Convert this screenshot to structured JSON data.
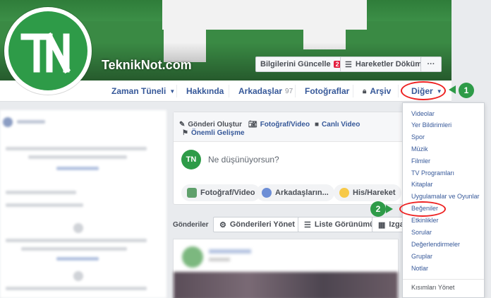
{
  "page": {
    "name": "TeknikNot.com",
    "avatar_letter": "TN"
  },
  "cover_buttons": {
    "update_info": "Bilgilerini Güncelle",
    "update_info_badge": "2",
    "activity_log": "Hareketler Dökümü",
    "more": "···"
  },
  "nav": {
    "timeline": "Zaman Tüneli",
    "about": "Hakkında",
    "friends": "Arkadaşlar",
    "friends_count": "97",
    "photos": "Fotoğraflar",
    "archive": "Arşiv",
    "more": "Diğer"
  },
  "composer": {
    "tab_create_post": "Gönderi Oluştur",
    "tab_photo_video": "Fotoğraf/Video",
    "tab_live_video": "Canlı Video",
    "tab_life_event": "Önemli Gelişme",
    "placeholder": "Ne düşünüyorsun?",
    "pill_photo_video": "Fotoğraf/Video",
    "pill_tag_friends": "Arkadaşların...",
    "pill_feeling": "His/Hareket"
  },
  "posts_bar": {
    "label": "Gönderiler",
    "manage": "Gönderileri Yönet",
    "list_view": "Liste Görünümü",
    "grid_view": "Izga"
  },
  "dropdown": {
    "items": [
      "Videolar",
      "Yer Bildirimleri",
      "Spor",
      "Müzik",
      "Filmler",
      "TV Programları",
      "Kitaplar",
      "Uygulamalar ve Oyunlar",
      "Beğeniler",
      "Etkinlikler",
      "Sorular",
      "Değerlendirmeler",
      "Gruplar",
      "Notlar"
    ],
    "manage_sections": "Kısımları Yönet"
  },
  "callouts": {
    "one": "1",
    "two": "2"
  },
  "colors": {
    "brand_green": "#2e9b48",
    "link_blue": "#365899",
    "highlight_red": "#e22"
  }
}
